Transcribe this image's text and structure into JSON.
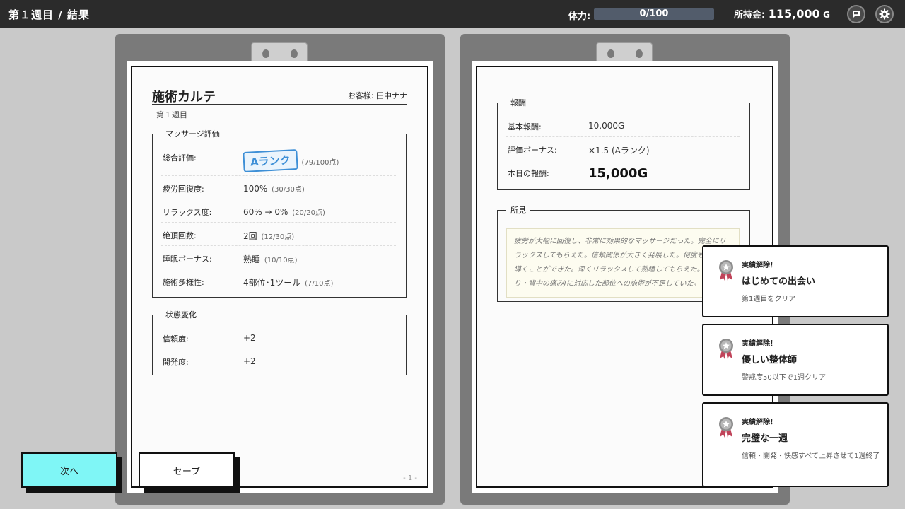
{
  "header": {
    "title": "第１週目 / 結果",
    "stamina_label": "体力:",
    "stamina_text": "0/100",
    "stamina_fraction": 0,
    "money_label": "所持金:",
    "money_value": "115,000",
    "money_unit": "G",
    "icons": [
      "chat-icon",
      "gear-icon"
    ]
  },
  "left_page": {
    "title": "施術カルテ",
    "customer": "お客様: 田中ナナ",
    "week": "第１週目",
    "massage_section": {
      "legend": "マッサージ評価",
      "rows": [
        {
          "label": "総合評価:",
          "value": "Aランク",
          "points": "(79/100点)"
        },
        {
          "label": "疲労回復度:",
          "value": "100%",
          "points": "(30/30点)"
        },
        {
          "label": "リラックス度:",
          "value": "60% → 0%",
          "points": "(20/20点)"
        },
        {
          "label": "絶頂回数:",
          "value": "2回",
          "points": "(12/30点)"
        },
        {
          "label": "睡眠ボーナス:",
          "value": "熟睡",
          "points": "(10/10点)"
        },
        {
          "label": "施術多様性:",
          "value": "4部位･1ツール",
          "points": "(7/10点)"
        }
      ]
    },
    "state_section": {
      "legend": "状態変化",
      "rows": [
        {
          "label": "信頼度:",
          "value": "+2"
        },
        {
          "label": "開発度:",
          "value": "+2"
        }
      ]
    },
    "page_number": "- 1 -"
  },
  "right_page": {
    "reward_section": {
      "legend": "報酬",
      "rows": [
        {
          "label": "基本報酬:",
          "value": "10,000G"
        },
        {
          "label": "評価ボーナス:",
          "value": "×1.5 (Aランク)"
        },
        {
          "label": "本日の報酬:",
          "value": "15,000G"
        }
      ]
    },
    "notes_section": {
      "legend": "所見",
      "text": "疲労が大幅に回復し、非常に効果的なマッサージだった。完全にリラックスしてもらえた。信頼関係が大きく発展した。何度も頂点へ導くことができた。深くリラックスして熟睡してもらえた。(肩こり・背中の痛み)に対応した部位への施術が不足していた。"
    }
  },
  "buttons": {
    "next": "次へ",
    "save": "セーブ"
  },
  "achievements": [
    {
      "header": "実績解除！",
      "name": "はじめての出会い",
      "desc": "第1週目をクリア"
    },
    {
      "header": "実績解除！",
      "name": "優しい整体師",
      "desc": "警戒度50以下で1週クリア"
    },
    {
      "header": "実績解除！",
      "name": "完璧な一週",
      "desc": "信頼・開発・快感すべて上昇させて1週終了"
    }
  ]
}
